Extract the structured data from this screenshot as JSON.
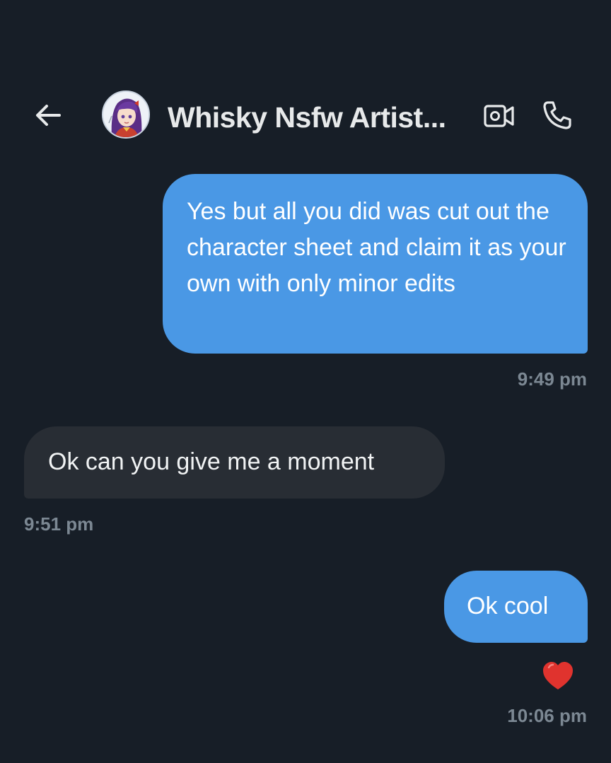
{
  "header": {
    "back_icon": "arrow-left-icon",
    "avatar_icon": "anime-girl-avatar",
    "title": "Whisky Nsfw Artist...",
    "video_icon": "video-camera-icon",
    "call_icon": "phone-icon"
  },
  "messages": [
    {
      "direction": "outgoing",
      "text": "Yes but all you did was cut out the character sheet and claim it as your own with only minor edits",
      "time": "9:49 pm"
    },
    {
      "direction": "incoming",
      "text": "Ok can you give me a moment",
      "time": "9:51 pm"
    },
    {
      "direction": "outgoing",
      "text": "Ok cool",
      "time": "10:06 pm",
      "reaction": "red-heart-icon"
    }
  ],
  "colors": {
    "background": "#171e27",
    "outgoing_bubble": "#4a98e5",
    "incoming_bubble": "#282d34",
    "timestamp": "#7c8893",
    "heart": "#e0332e"
  }
}
